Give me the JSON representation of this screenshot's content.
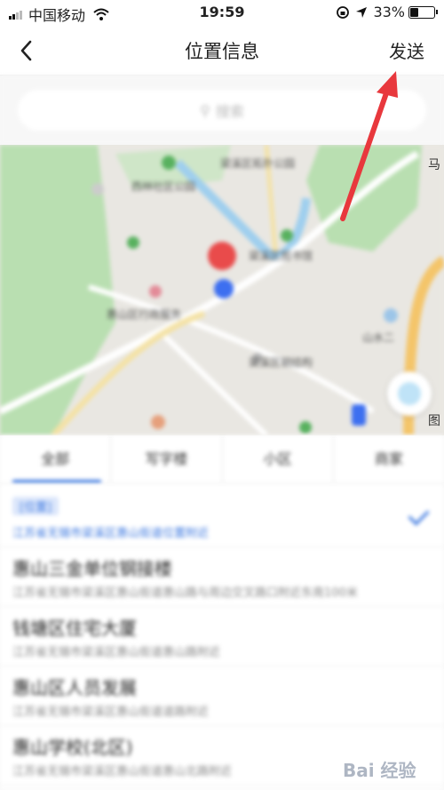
{
  "status_bar": {
    "carrier": "中国移动",
    "time": "19:59",
    "battery": "33%",
    "battery_level": 0.33
  },
  "nav": {
    "title": "位置信息",
    "send_label": "发送"
  },
  "search": {
    "placeholder": "搜索"
  },
  "map": {
    "edge_label_top": "马",
    "edge_label_bottom": "图",
    "labels": [
      "梁溪区拓扑公园",
      "西林社区公园",
      "梁溪区图书馆",
      "惠山区行政服务",
      "山水二",
      "梁溪区钢结构"
    ]
  },
  "tabs": [
    "全部",
    "写字楼",
    "小区",
    "商家"
  ],
  "list": {
    "selected_tag": "[位置]",
    "selected_address": "江苏省无锡市梁溪区惠山街道位置附近",
    "items": [
      {
        "title": "惠山三金单位钢接楼",
        "sub": "江苏省无锡市梁溪区惠山街道惠山路与周边交叉路口附近东南100米"
      },
      {
        "title": "钱塘区住宅大厦",
        "sub": "江苏省无锡市梁溪区惠山街道惠山路附近"
      },
      {
        "title": "惠山区人员发展",
        "sub": "江苏省无锡市梁溪区惠山街道道路附近"
      },
      {
        "title": "惠山学校(北区)",
        "sub": "江苏省无锡市梁溪区惠山街道惠山北路附近"
      }
    ]
  },
  "watermark": "Bai 经验",
  "colors": {
    "accent": "#3f7ae0",
    "arrow": "#e8383d",
    "map_green": "#b9dfb1",
    "map_background": "#e9e7e2"
  }
}
